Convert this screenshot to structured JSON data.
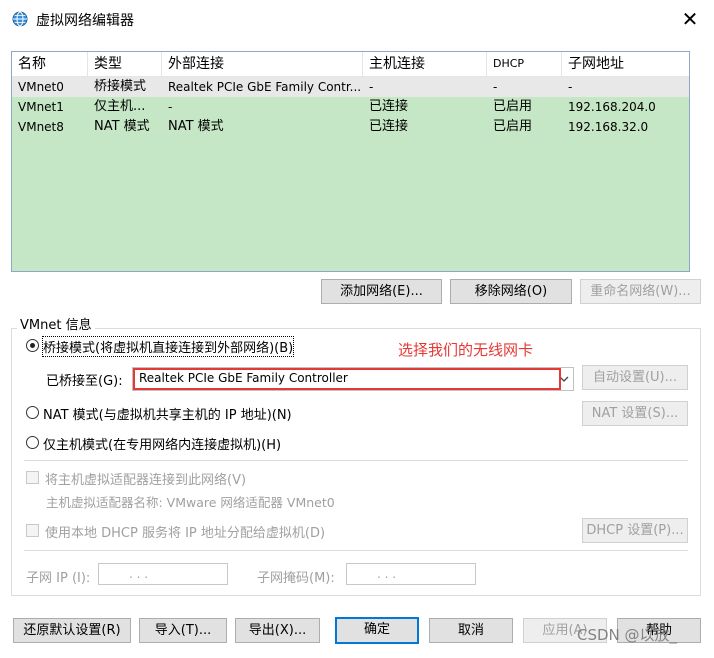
{
  "window": {
    "title": "虚拟网络编辑器",
    "close_glyph": "✕"
  },
  "table": {
    "headers": [
      "名称",
      "类型",
      "外部连接",
      "主机连接",
      "DHCP",
      "子网地址"
    ],
    "rows": [
      [
        "VMnet0",
        "桥接模式",
        "Realtek PCIe GbE Family Contr...",
        "-",
        "-",
        "-"
      ],
      [
        "VMnet1",
        "仅主机...",
        "-",
        "已连接",
        "已启用",
        "192.168.204.0"
      ],
      [
        "VMnet8",
        "NAT 模式",
        "NAT 模式",
        "已连接",
        "已启用",
        "192.168.32.0"
      ]
    ],
    "selected_row": 0
  },
  "network_buttons": {
    "add": "添加网络(E)...",
    "remove": "移除网络(O)",
    "rename": "重命名网络(W)..."
  },
  "vmnet_info": {
    "group_label": "VMnet 信息",
    "bridged_label": "桥接模式(将虚拟机直接连接到外部网络)(B)",
    "bridged_to_label": "已桥接至(G):",
    "bridged_to_value": "Realtek PCIe GbE Family Controller",
    "auto_settings": "自动设置(U)...",
    "nat_label": "NAT 模式(与虚拟机共享主机的 IP 地址)(N)",
    "nat_settings": "NAT 设置(S)...",
    "hostonly_label": "仅主机模式(在专用网络内连接虚拟机)(H)",
    "connect_adapter_label": "将主机虚拟适配器连接到此网络(V)",
    "adapter_name_label": "主机虚拟适配器名称: VMware 网络适配器 VMnet0",
    "dhcp_label": "使用本地 DHCP 服务将 IP 地址分配给虚拟机(D)",
    "dhcp_settings": "DHCP 设置(P)...",
    "subnet_ip_label": "子网 IP (I):",
    "subnet_ip_value": ".      .      .",
    "subnet_mask_label": "子网掩码(M):",
    "subnet_mask_value": ".      .      .",
    "selected_mode": "bridged"
  },
  "annotation": "选择我们的无线网卡",
  "footer_buttons": {
    "restore": "还原默认设置(R)",
    "import": "导入(T)...",
    "export": "导出(X)...",
    "ok": "确定",
    "cancel": "取消",
    "apply": "应用(A)",
    "help": "帮助"
  },
  "watermark": "CSDN @以放_",
  "colors": {
    "table_bg": "#c6e7c6",
    "accent": "#0078d7",
    "annotation": "#e53935"
  },
  "icons": {
    "title_icon": "network-globe-icon",
    "dropdown": "chevron-down-icon"
  }
}
